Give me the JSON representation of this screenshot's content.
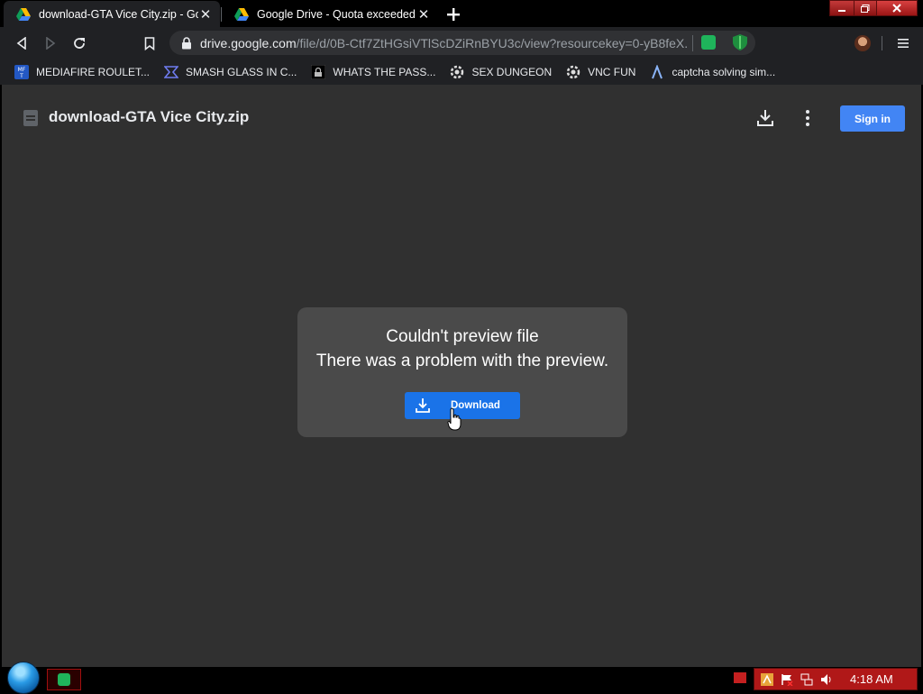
{
  "browser": {
    "tabs": [
      {
        "title": "download-GTA Vice City.zip - Google Drive",
        "active": true,
        "icon": "google-drive-icon"
      },
      {
        "title": "Google Drive - Quota exceeded",
        "active": false,
        "icon": "google-drive-icon"
      }
    ],
    "new_tab_icon": "plus-icon",
    "url_host": "drive.google.com",
    "url_rest": "/file/d/0B-Ctf7ZtHGsiVTlScDZiRnBYU3c/view?resourcekey=0-yB8feX...",
    "bookmarks": [
      {
        "label": "MEDIAFIRE ROULET...",
        "icon": "mediafire-icon"
      },
      {
        "label": "SMASH GLASS IN C...",
        "icon": "glass-icon"
      },
      {
        "label": "WHATS THE PASS...",
        "icon": "lock-site-icon"
      },
      {
        "label": "SEX DUNGEON",
        "icon": "gear-site-icon"
      },
      {
        "label": "VNC FUN",
        "icon": "gear-site-icon"
      },
      {
        "label": "captcha solving sim...",
        "icon": "lambda-icon"
      }
    ]
  },
  "drive": {
    "file_name": "download-GTA Vice City.zip",
    "sign_in_label": "Sign in",
    "error_title": "Couldn't preview file",
    "error_message": "There was a problem with the preview.",
    "download_label": "Download"
  },
  "taskbar": {
    "clock": "4:18 AM"
  },
  "colors": {
    "viewer_bg": "#303030",
    "dialog_bg": "#4a4a4a",
    "accent_blue": "#1a73e8",
    "sign_in_blue": "#4285f4",
    "tray_red": "#b01818"
  }
}
